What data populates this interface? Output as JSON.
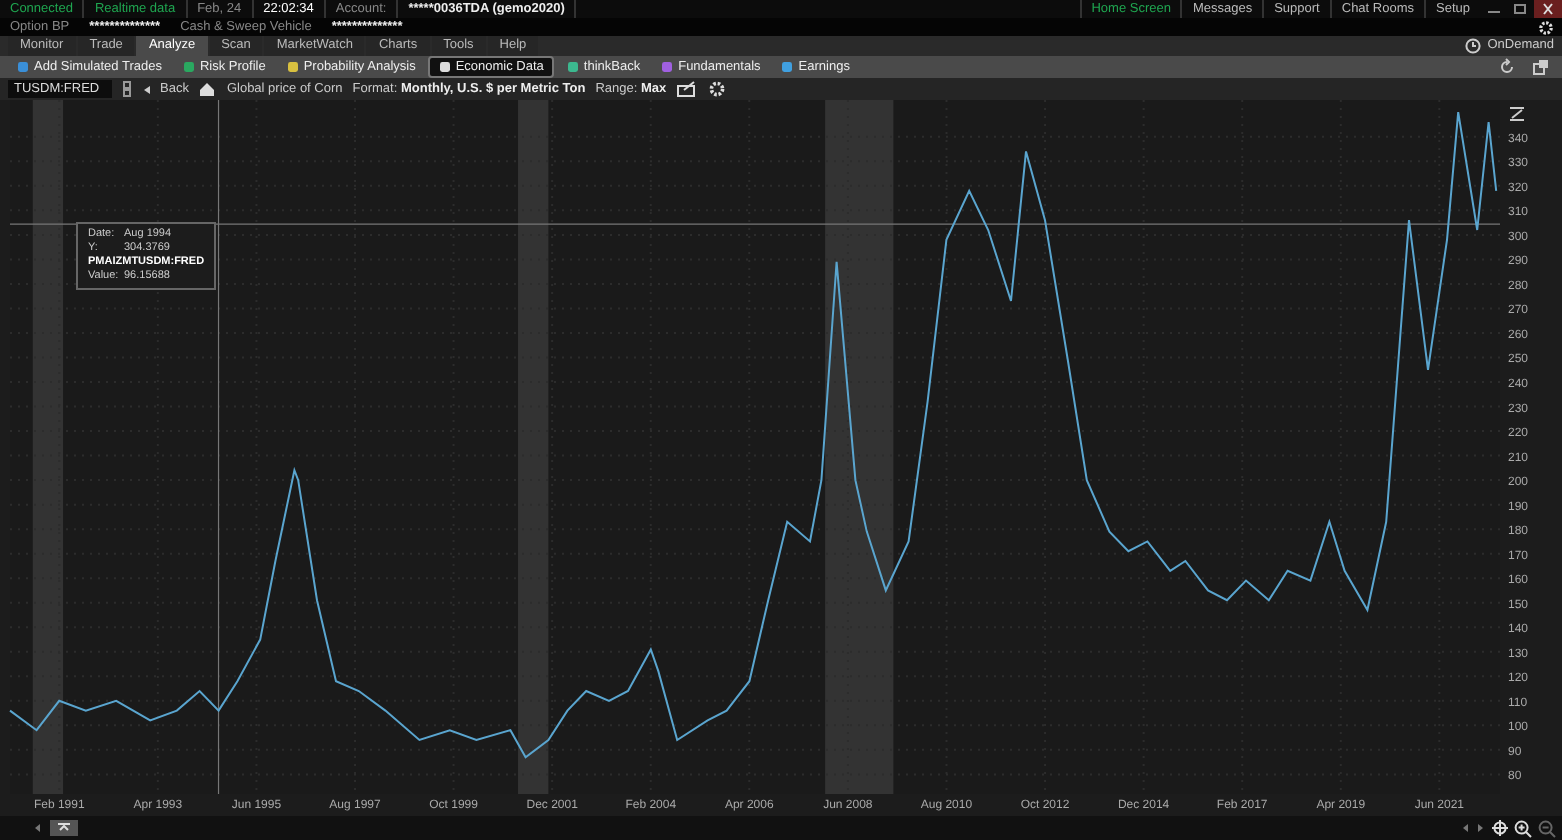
{
  "status_bar": {
    "items": [
      {
        "kind": "status",
        "text": "Connected"
      },
      {
        "kind": "status",
        "text": "Realtime data"
      },
      {
        "kind": "label",
        "text": "Feb, 24"
      },
      {
        "kind": "time",
        "text": "22:02:34"
      },
      {
        "kind": "label",
        "text": "Account:"
      },
      {
        "kind": "value",
        "text": "*****0036TDA (gemo2020)"
      }
    ],
    "links": [
      {
        "label": "Home Screen",
        "selected": true
      },
      {
        "label": "Messages",
        "selected": false
      },
      {
        "label": "Support",
        "selected": false
      },
      {
        "label": "Chat Rooms",
        "selected": false
      },
      {
        "label": "Setup",
        "selected": false
      }
    ]
  },
  "account_bar": {
    "items": [
      {
        "kind": "label",
        "text": "Option BP"
      },
      {
        "kind": "value",
        "text": "**************"
      },
      {
        "kind": "label",
        "text": "Cash & Sweep Vehicle"
      },
      {
        "kind": "value",
        "text": "**************"
      }
    ]
  },
  "tabs": [
    {
      "label": "Monitor",
      "selected": false
    },
    {
      "label": "Trade",
      "selected": false
    },
    {
      "label": "Analyze",
      "selected": true
    },
    {
      "label": "Scan",
      "selected": false
    },
    {
      "label": "MarketWatch",
      "selected": false
    },
    {
      "label": "Charts",
      "selected": false
    },
    {
      "label": "Tools",
      "selected": false
    },
    {
      "label": "Help",
      "selected": false
    }
  ],
  "ondemand": "OnDemand",
  "toolbar": [
    {
      "label": "Add Simulated Trades",
      "selected": false
    },
    {
      "label": "Risk Profile",
      "selected": false
    },
    {
      "label": "Probability Analysis",
      "selected": false
    },
    {
      "label": "Economic Data",
      "selected": true
    },
    {
      "label": "thinkBack",
      "selected": false
    },
    {
      "label": "Fundamentals",
      "selected": false
    },
    {
      "label": "Earnings",
      "selected": false
    }
  ],
  "chart_toolbar": {
    "symbol": "TUSDM:FRED",
    "back": "Back",
    "series_title": "Global price of Corn",
    "format_label": "Format:",
    "format_value": "Monthly, U.S. $ per Metric Ton",
    "range_label": "Range:",
    "range_value": "Max"
  },
  "chart": {
    "tooltip": [
      {
        "kind": "pair",
        "label": "Date:",
        "value": "Aug 1994"
      },
      {
        "kind": "pair",
        "label": "Y:",
        "value": "304.3769"
      },
      {
        "kind": "title",
        "label": "PMAIZMTUSDM:FRED"
      },
      {
        "kind": "pair",
        "label": "Value:",
        "value": "96.15688"
      }
    ],
    "chart_data": {
      "type": "line",
      "x": [
        "1990-01",
        "1990-08",
        "1991-02",
        "1991-09",
        "1992-05",
        "1993-02",
        "1993-09",
        "1994-03",
        "1994-08",
        "1995-01",
        "1995-07",
        "1995-11",
        "1996-04",
        "1996-05",
        "1996-10",
        "1997-03",
        "1997-09",
        "1998-04",
        "1999-01",
        "1999-09",
        "2000-04",
        "2001-01",
        "2001-05",
        "2001-11",
        "2002-04",
        "2002-09",
        "2003-03",
        "2003-08",
        "2004-02",
        "2004-04",
        "2004-09",
        "2005-05",
        "2005-10",
        "2006-04",
        "2006-09",
        "2007-02",
        "2007-08",
        "2007-11",
        "2008-03",
        "2008-08",
        "2008-11",
        "2009-04",
        "2009-10",
        "2010-03",
        "2010-08",
        "2011-02",
        "2011-07",
        "2012-01",
        "2012-05",
        "2012-10",
        "2013-04",
        "2013-09",
        "2014-03",
        "2014-08",
        "2015-01",
        "2015-07",
        "2015-11",
        "2016-05",
        "2016-10",
        "2017-03",
        "2017-09",
        "2018-02",
        "2018-08",
        "2019-01",
        "2019-05",
        "2019-11",
        "2020-04",
        "2020-10",
        "2021-03",
        "2021-08",
        "2021-11",
        "2022-04",
        "2022-07",
        "2022-09"
      ],
      "series": [
        {
          "color": "#5aa5cf",
          "values": [
            106,
            98,
            110,
            106,
            110,
            102,
            106,
            114,
            106,
            118,
            135,
            167,
            204,
            200,
            151,
            118,
            114,
            106,
            94,
            98,
            94,
            98,
            87,
            94,
            106,
            114,
            110,
            114,
            131,
            122,
            94,
            102,
            106,
            118,
            151,
            183,
            175,
            200,
            289,
            200,
            179,
            155,
            175,
            232,
            298,
            318,
            302,
            273,
            334,
            306,
            249,
            200,
            179,
            171,
            175,
            163,
            167,
            155,
            151,
            159,
            151,
            163,
            159,
            183,
            163,
            147,
            183,
            306,
            245,
            298,
            350,
            302,
            346,
            318
          ]
        }
      ],
      "xlim": [
        "1990-01",
        "2022-10"
      ],
      "ylim": [
        72,
        355
      ],
      "xticks": [
        {
          "value": "1991-02",
          "label": "Feb 1991"
        },
        {
          "value": "1993-04",
          "label": "Apr 1993"
        },
        {
          "value": "1995-06",
          "label": "Jun 1995"
        },
        {
          "value": "1997-08",
          "label": "Aug 1997"
        },
        {
          "value": "1999-10",
          "label": "Oct 1999"
        },
        {
          "value": "2001-12",
          "label": "Dec 2001"
        },
        {
          "value": "2004-02",
          "label": "Feb 2004"
        },
        {
          "value": "2006-04",
          "label": "Apr 2006"
        },
        {
          "value": "2008-06",
          "label": "Jun 2008"
        },
        {
          "value": "2010-08",
          "label": "Aug 2010"
        },
        {
          "value": "2012-10",
          "label": "Oct 2012"
        },
        {
          "value": "2014-12",
          "label": "Dec 2014"
        },
        {
          "value": "2017-02",
          "label": "Feb 2017"
        },
        {
          "value": "2019-04",
          "label": "Apr 2019"
        },
        {
          "value": "2021-06",
          "label": "Jun 2021"
        }
      ],
      "yticks": [
        80,
        90,
        100,
        110,
        120,
        130,
        140,
        150,
        160,
        170,
        180,
        190,
        200,
        210,
        220,
        230,
        240,
        250,
        260,
        270,
        280,
        290,
        300,
        310,
        320,
        330,
        340
      ],
      "grid": true,
      "bands": [
        {
          "axis": "x",
          "from": "1990-07",
          "to": "1991-03"
        },
        {
          "axis": "x",
          "from": "2001-03",
          "to": "2001-11"
        },
        {
          "axis": "x",
          "from": "2007-12",
          "to": "2009-06"
        }
      ],
      "ref_lines": [
        {
          "axis": "x",
          "value": "1994-08"
        },
        {
          "axis": "y",
          "value": 304.3769
        }
      ]
    }
  }
}
